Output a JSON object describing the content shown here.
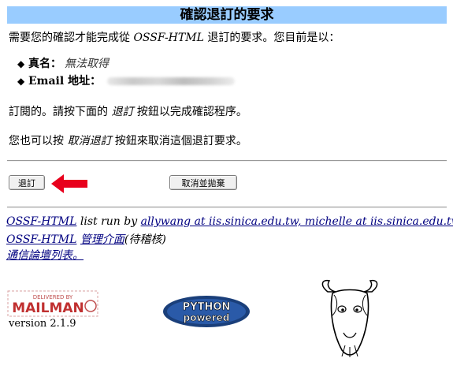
{
  "title": "確認退訂的要求",
  "intro": {
    "prefix": "需要您的確認才能完成從 ",
    "list_name": "OSSF-HTML",
    "suffix": " 退訂的要求。您目前是以："
  },
  "info": {
    "realname_label": "真名：",
    "realname_value": "無法取得",
    "email_label": "Email 地址："
  },
  "instruction": {
    "prefix": "訂閱的。請按下面的 ",
    "button_ref": "退訂",
    "suffix": " 按鈕以完成確認程序。"
  },
  "cancel_instruction": {
    "prefix": "您也可以按 ",
    "button_ref": "取消退訂",
    "suffix": " 按鈕來取消這個退訂要求。"
  },
  "buttons": {
    "unsubscribe": "退訂",
    "cancel": "取消並拋棄"
  },
  "footer": {
    "list_link": "OSSF-HTML",
    "run_by": " list run by ",
    "owners_link": "allywang at iis.sinica.edu.tw, michelle at iis.sinica.edu.tw",
    "admin_list": "OSSF-HTML",
    "admin_link": "管理介面",
    "admin_note": "(待稽核)",
    "overview_link": "通信論壇列表。"
  },
  "logos": {
    "mailman_top": "DELIVERED BY",
    "mailman": "MAILMAN",
    "python_line1": "PYTHON",
    "python_line2": "powered"
  },
  "version": "version 2.1.9",
  "colors": {
    "title_bg": "#99ccff",
    "link": "#000080",
    "arrow": "#e8001c"
  }
}
